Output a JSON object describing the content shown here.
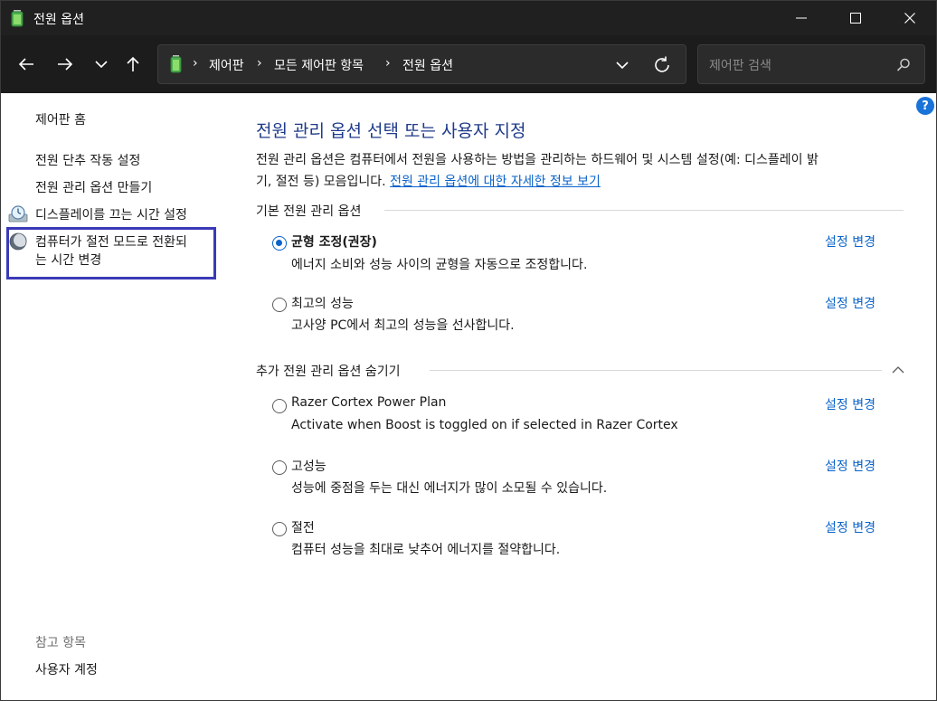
{
  "window": {
    "title": "전원 옵션",
    "accent": "#0a63c9",
    "title_color": "#1e3a8a"
  },
  "nav": {
    "breadcrumbs": [
      "제어판",
      "모든 제어판 항목",
      "전원 옵션"
    ],
    "separator": "›",
    "search_placeholder": "제어판 검색",
    "help": "?"
  },
  "sidebar": {
    "home": "제어판 홈",
    "links": [
      "전원 단추 작동 설정",
      "전원 관리 옵션 만들기",
      "디스플레이를 끄는 시간 설정",
      "컴퓨터가 절전 모드로 전환되",
      "는 시간 변경"
    ],
    "see_also_label": "참고 항목",
    "see_also_links": [
      "사용자 계정"
    ]
  },
  "main": {
    "title": "전원 관리 옵션 선택 또는 사용자 지정",
    "desc_line1": "전원 관리 옵션은 컴퓨터에서 전원을 사용하는 방법을 관리하는 하드웨어 및 시스템 설정(예: 디스플레이 밝",
    "desc_line2_prefix": "기, 절전 등) 모음입니다. ",
    "desc_link": "전원 관리 옵션에 대한 자세한 정보 보기",
    "basic_section": "기본 전원 관리 옵션",
    "extra_section": "추가 전원 관리 옵션 숨기기",
    "change_label": "설정 변경",
    "plans": [
      {
        "name": "균형 조정(권장)",
        "desc": "에너지 소비와 성능 사이의 균형을 자동으로 조정합니다.",
        "selected": true
      },
      {
        "name": "최고의 성능",
        "desc": "고사양 PC에서 최고의 성능을 선사합니다.",
        "selected": false
      },
      {
        "name": "Razer Cortex Power Plan",
        "desc": "Activate when Boost is toggled on if selected in Razer Cortex",
        "selected": false
      },
      {
        "name": "고성능",
        "desc": "성능에 중점을 두는 대신 에너지가 많이 소모될 수 있습니다.",
        "selected": false
      },
      {
        "name": "절전",
        "desc": "컴퓨터 성능을 최대로 낮추어 에너지를 절약합니다.",
        "selected": false
      }
    ]
  }
}
